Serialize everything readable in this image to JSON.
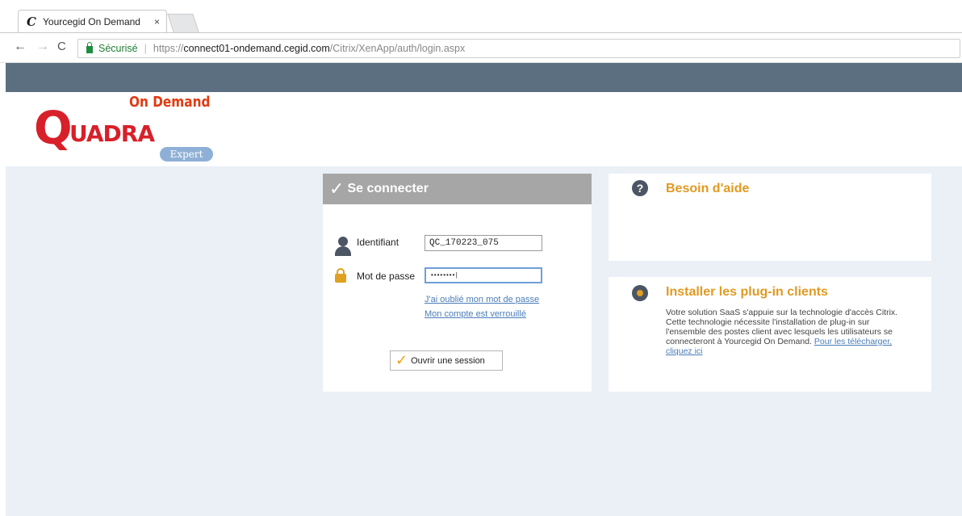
{
  "browser": {
    "tab_favicon": "C",
    "tab_title": "Yourcegid On Demand",
    "tab_close": "×",
    "nav_back": "←",
    "nav_forward": "→",
    "nav_reload": "C",
    "secure_label": "Sécurisé",
    "url_scheme": "https://",
    "url_host": "connect01-ondemand.cegid.com",
    "url_path": "/Citrix/XenApp/auth/login.aspx"
  },
  "logo": {
    "q": "Q",
    "uadra": "UADRA",
    "on_demand": "On Demand",
    "expert": "Expert"
  },
  "login": {
    "title": "Se connecter",
    "check": "✓",
    "identifiant_label": "Identifiant",
    "identifiant_value": "QC_170223_075",
    "password_label": "Mot de passe",
    "password_value": "••••••••|",
    "forgot_link": "J'ai oublié mon mot de passe",
    "locked_link": "Mon compte est verrouillé",
    "submit_label": "Ouvrir une session"
  },
  "help": {
    "icon": "?",
    "title": "Besoin d'aide"
  },
  "plugins": {
    "title": "Installer les plug-in clients",
    "text_line1": "Votre solution SaaS s'appuie sur la technologie d'accès Citrix.",
    "text_line2": "Cette technologie nécessite l'installation de plug-in sur l'ensemble des postes client avec lesquels les utilisateurs se connecteront à Yourcegid On Demand.",
    "link": "Pour les télécharger, cliquez ici"
  },
  "colors": {
    "banner": "#5c6f80",
    "content_bg": "#eaf0f6",
    "accent_orange": "#e09a22",
    "logo_red": "#d8202a",
    "link_blue": "#4a7db8"
  }
}
